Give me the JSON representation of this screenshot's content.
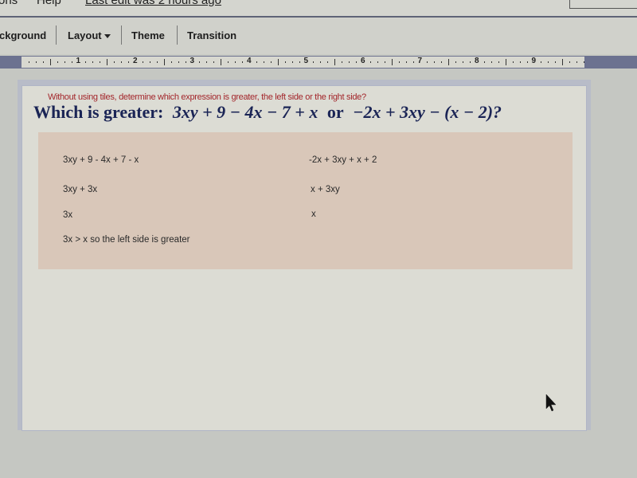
{
  "menubar": {
    "items": [
      "ons",
      "Help"
    ],
    "last_edit": "Last edit was 2 hours ago"
  },
  "toolbar": {
    "background_label": "ckground",
    "layout_label": "Layout",
    "theme_label": "Theme",
    "transition_label": "Transition"
  },
  "ruler": {
    "numbers": [
      "1",
      "2",
      "3",
      "4",
      "5",
      "6",
      "7",
      "8",
      "9"
    ]
  },
  "slide": {
    "instruction": "Without using tiles, determine which expression is greater, the left side or the right side?",
    "question_label": "Which is greater:",
    "left_expression": "3xy + 9 − 4x − 7 + x",
    "connector": "or",
    "right_expression": "−2x + 3xy − (x − 2)?",
    "left_steps": [
      "3xy + 9 - 4x + 7 - x",
      "3xy + 3x",
      "3x",
      "3x > x so the left side is greater"
    ],
    "right_steps": [
      "-2x + 3xy + x + 2",
      "x + 3xy",
      "x"
    ]
  },
  "colors": {
    "instruction": "#a3262b",
    "question": "#1a2455",
    "workbox": "#d9c7b9",
    "ruler_frame": "#6c7290"
  }
}
